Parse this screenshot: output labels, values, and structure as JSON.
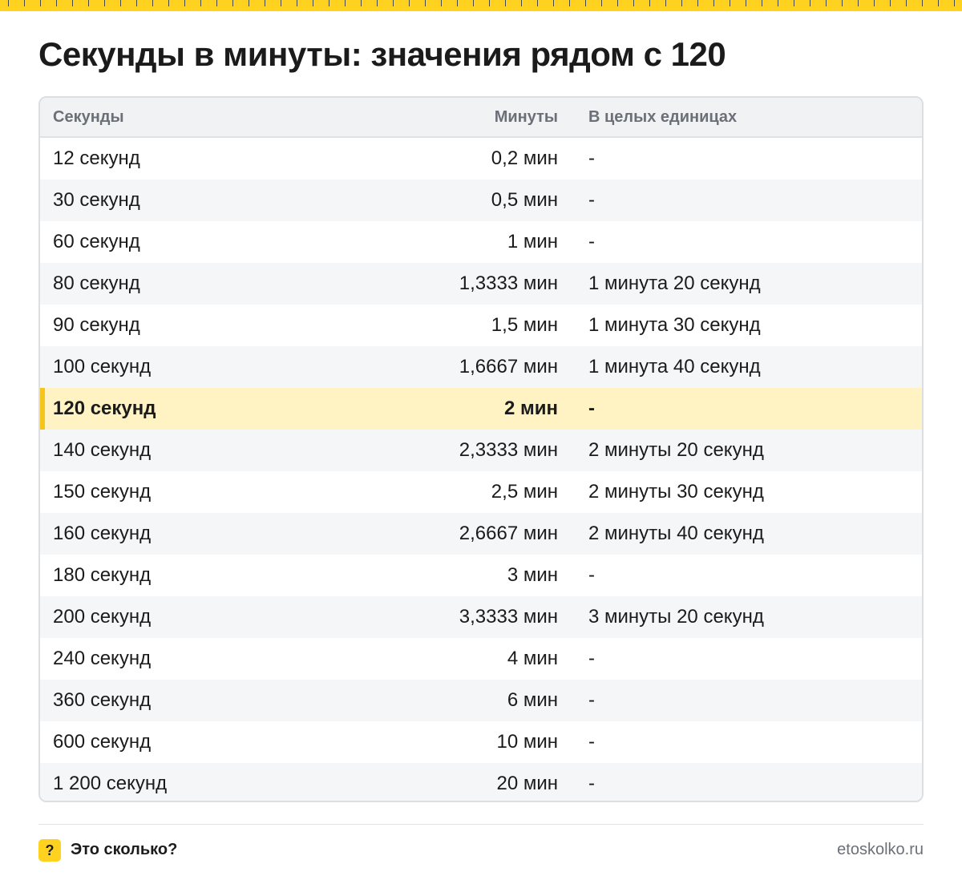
{
  "title": "Секунды в минуты: значения рядом с 120",
  "table": {
    "headers": [
      "Секунды",
      "Минуты",
      "В целых единицах"
    ],
    "rows": [
      [
        "12 секунд",
        "0,2 мин",
        "-"
      ],
      [
        "30 секунд",
        "0,5 мин",
        "-"
      ],
      [
        "60 секунд",
        "1 мин",
        "-"
      ],
      [
        "80 секунд",
        "1,3333 мин",
        "1 минута 20 секунд"
      ],
      [
        "90 секунд",
        "1,5 мин",
        "1 минута 30 секунд"
      ],
      [
        "100 секунд",
        "1,6667 мин",
        "1 минута 40 секунд"
      ],
      [
        "120 секунд",
        "2 мин",
        "-"
      ],
      [
        "140 секунд",
        "2,3333 мин",
        "2 минуты 20 секунд"
      ],
      [
        "150 секунд",
        "2,5 мин",
        "2 минуты 30 секунд"
      ],
      [
        "160 секунд",
        "2,6667 мин",
        "2 минуты 40 секунд"
      ],
      [
        "180 секунд",
        "3 мин",
        "-"
      ],
      [
        "200 секунд",
        "3,3333 мин",
        "3 минуты 20 секунд"
      ],
      [
        "240 секунд",
        "4 мин",
        "-"
      ],
      [
        "360 секунд",
        "6 мин",
        "-"
      ],
      [
        "600 секунд",
        "10 мин",
        "-"
      ],
      [
        "1 200 секунд",
        "20 мин",
        "-"
      ]
    ],
    "highlight_row": 6
  },
  "footer": {
    "logo_glyph": "?",
    "brand": "Это сколько?",
    "site": "etoskolko.ru"
  },
  "colors": {
    "accent": "#ffd21f",
    "highlight_bg": "#fff3c4",
    "highlight_bar": "#f5c518"
  }
}
